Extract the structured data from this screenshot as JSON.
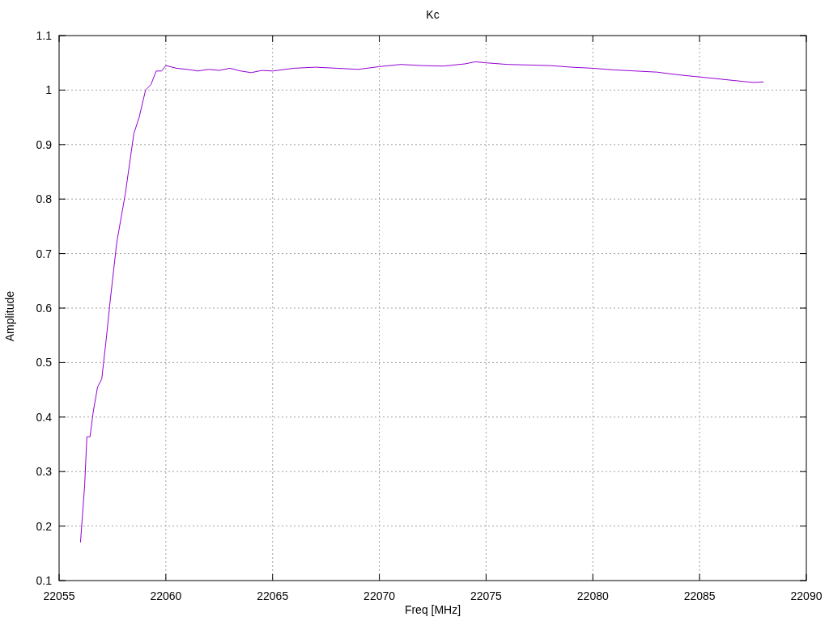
{
  "chart_data": {
    "type": "line",
    "title": "Kc",
    "xlabel": "Freq [MHz]",
    "ylabel": "Amplitude",
    "x": [
      22056,
      22056.2,
      22056.3,
      22056.45,
      22056.6,
      22056.8,
      22057,
      22057.2,
      22057.4,
      22057.7,
      22058.1,
      22058.5,
      22058.75,
      22059.05,
      22059.3,
      22059.55,
      22059.8,
      22060,
      22060.5,
      22061,
      22061.5,
      22062,
      22062.5,
      22063,
      22063.5,
      22064,
      22064.5,
      22065,
      22066,
      22067,
      22068,
      22069,
      22070,
      22071,
      22072,
      22073,
      22074,
      22074.5,
      22075,
      22076,
      22077,
      22078,
      22079,
      22080,
      22081,
      22082,
      22083,
      22084,
      22085,
      22086,
      22087,
      22087.5,
      22088
    ],
    "grid": true,
    "series": [
      {
        "color": "#9400d3",
        "values": [
          0.17,
          0.275,
          0.364,
          0.364,
          0.41,
          0.455,
          0.47,
          0.54,
          0.616,
          0.72,
          0.81,
          0.92,
          0.95,
          1.0,
          1.01,
          1.035,
          1.035,
          1.045,
          1.04,
          1.038,
          1.035,
          1.038,
          1.036,
          1.04,
          1.035,
          1.032,
          1.036,
          1.035,
          1.04,
          1.042,
          1.04,
          1.038,
          1.043,
          1.047,
          1.045,
          1.044,
          1.048,
          1.052,
          1.05,
          1.047,
          1.046,
          1.045,
          1.042,
          1.04,
          1.037,
          1.035,
          1.033,
          1.028,
          1.024,
          1.02,
          1.016,
          1.014,
          1.015
        ]
      }
    ],
    "xlim": [
      22055,
      22090
    ],
    "ylim": [
      0.1,
      1.1
    ],
    "xticks": [
      22055,
      22060,
      22065,
      22070,
      22075,
      22080,
      22085,
      22090
    ],
    "yticks": [
      0.1,
      0.2,
      0.3,
      0.4,
      0.5,
      0.6,
      0.7,
      0.8,
      0.9,
      {
        "value": 1,
        "label": "1"
      },
      1.1
    ]
  }
}
